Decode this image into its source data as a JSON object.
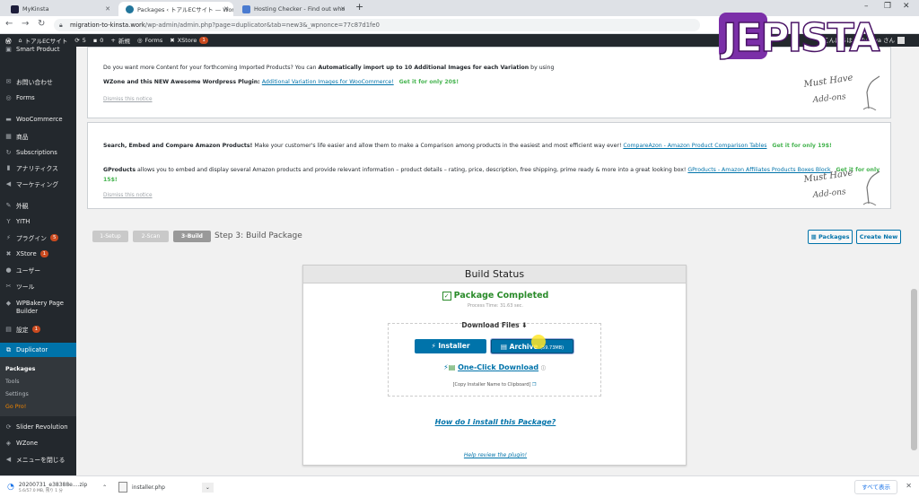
{
  "browser": {
    "tabs": [
      {
        "title": "MyKinsta",
        "active": false
      },
      {
        "title": "Packages ‹ トアルECサイト — Wor",
        "active": true
      },
      {
        "title": "Hosting Checker - Find out who",
        "active": false
      }
    ],
    "new_tab_icon": "plus-icon",
    "url_host": "migration-to-kinsta.work",
    "url_path": "/wp-admin/admin.php?page=duplicator&tab=new3&_wpnonce=77c87d1fe0"
  },
  "adminbar": {
    "site_name": "トアルECサイト",
    "updates_count": "5",
    "comments_count": "0",
    "new_label": "新規",
    "forms_label": "Forms",
    "xstore_label": "XStore",
    "xstore_badge": "1",
    "howdy": "こんにちは、yfukaya さん"
  },
  "sidebar": {
    "items": [
      {
        "label": "Smart Product",
        "icon": "box-icon"
      },
      {
        "label": "お問い合わせ",
        "icon": "mail-icon"
      },
      {
        "label": "Forms",
        "icon": "forms-icon"
      },
      {
        "label": "WooCommerce",
        "icon": "woo-icon"
      },
      {
        "label": "商品",
        "icon": "product-icon"
      },
      {
        "label": "Subscriptions",
        "icon": "subscription-icon"
      },
      {
        "label": "アナリティクス",
        "icon": "chart-icon"
      },
      {
        "label": "マーケティング",
        "icon": "megaphone-icon"
      },
      {
        "label": "外観",
        "icon": "brush-icon"
      },
      {
        "label": "YITH",
        "icon": "yith-icon"
      },
      {
        "label": "プラグイン",
        "icon": "plugin-icon",
        "badge": "5"
      },
      {
        "label": "XStore",
        "icon": "xstore-icon",
        "badge": "1"
      },
      {
        "label": "ユーザー",
        "icon": "user-icon"
      },
      {
        "label": "ツール",
        "icon": "wrench-icon"
      },
      {
        "label": "WPBakery Page Builder",
        "icon": "wpbakery-icon"
      },
      {
        "label": "設定",
        "icon": "settings-icon",
        "badge": "1"
      },
      {
        "label": "Duplicator",
        "icon": "duplicator-icon",
        "current": true
      },
      {
        "label": "Slider Revolution",
        "icon": "slider-icon"
      },
      {
        "label": "WZone",
        "icon": "wzone-icon"
      },
      {
        "label": "メニューを閉じる",
        "icon": "collapse-icon"
      }
    ],
    "submenu": [
      "Packages",
      "Tools",
      "Settings",
      "Go Pro!"
    ]
  },
  "notice1": {
    "line1": "Do you want more Content for your forthcoming Imported Products? You can ",
    "line1_bold": "Automatically import up to 10 Additional Images for each Variation",
    "line1_end": " by using",
    "line2_prefix": "WZone and this NEW Awesome Wordpress Plugin: ",
    "line2_link": "Additional Variation Images for WooCommerce!",
    "line2_offer": "Get it for only 20$!",
    "dismiss": "Dismiss this notice",
    "badge_line1": "Must Have",
    "badge_line2": "Add-ons"
  },
  "notice2": {
    "p1_bold": "Search, Embed and Compare Amazon Products!",
    "p1_text": " Make your customer's life easier and allow them to make a Comparison among products in the easiest and most efficient way ever! ",
    "p1_link": "CompareAzon - Amazon Product Comparison Tables",
    "p1_offer": "Get it for only 19$!",
    "p2_bold": "GProducts",
    "p2_text": " allows you to embed and display several Amazon products and provide relevant information – product details – rating, price, description, free shipping, prime ready & more into a great looking box! ",
    "p2_link": "GProducts - Amazon Affiliates Products Boxes Block",
    "p2_offer": "Get it for only",
    "p2_offer2": "15$!",
    "dismiss": "Dismiss this notice",
    "badge_line1": "Must Have",
    "badge_line2": "Add-ons"
  },
  "steps": {
    "step1": "1-Setup",
    "step2": "2-Scan",
    "step3": "3-Build",
    "title": "Step 3: Build Package",
    "packages_btn": "Packages",
    "create_new_btn": "Create New"
  },
  "build": {
    "header": "Build Status",
    "completed": "Package Completed",
    "process_time": "Process Time: 31.63 sec.",
    "download_files": "Download Files",
    "installer_btn": "Installer",
    "archive_btn": "Archive",
    "archive_size": "(59.73MB)",
    "one_click": "One-Click Download",
    "copy_installer": "[Copy Installer Name to Clipboard]",
    "how_install": "How do I install this Package?",
    "review": "Help review the plugin!"
  },
  "downloads": {
    "file1": "20200731_e38388e....zip",
    "file1_sub": "5.6/57.0 MB, 残り 1 分",
    "file2": "installer.php",
    "show_all": "すべて表示"
  },
  "logo": {
    "text": "JEPISTA"
  },
  "colors": {
    "wp_dark": "#23282d",
    "wp_blue": "#0073aa",
    "success_green": "#2a8b2a",
    "offer_green": "#46b450",
    "logo_purple": "#7b2fa8"
  }
}
